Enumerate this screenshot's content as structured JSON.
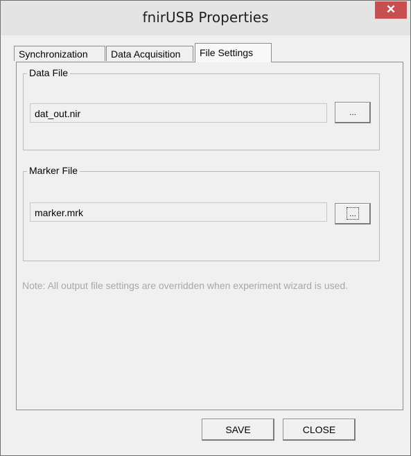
{
  "window": {
    "title": "fnirUSB Properties",
    "close_glyph": "✕",
    "close_icon": "close-icon"
  },
  "tabs": [
    {
      "label": "Synchronization",
      "active": false
    },
    {
      "label": "Data Acquisition",
      "active": false
    },
    {
      "label": "File Settings",
      "active": true
    }
  ],
  "data_file": {
    "group_label": "Data File",
    "value": "dat_out.nir",
    "browse_label": "..."
  },
  "marker_file": {
    "group_label": "Marker File",
    "value": "marker.mrk",
    "browse_label": "..."
  },
  "note": "Note: All output file settings are overridden when experiment wizard is used.",
  "footer": {
    "save_label": "SAVE",
    "close_label": "CLOSE"
  }
}
